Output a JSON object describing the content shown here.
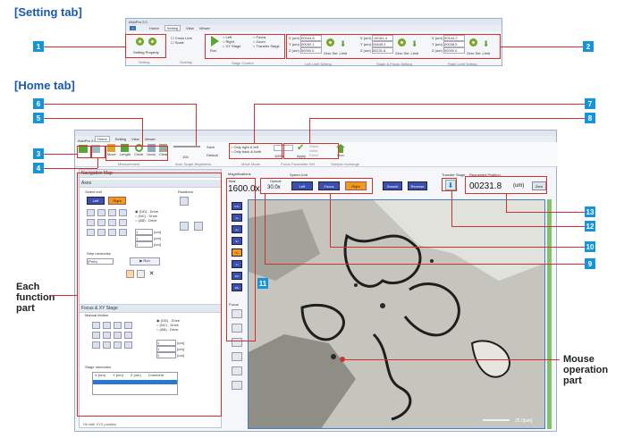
{
  "sections": {
    "setting_tab": "[Setting tab]",
    "home_tab": "[Home tab]"
  },
  "setting": {
    "app_title": "AxioPro 2.0",
    "tabs": [
      "Home",
      "Setting",
      "View",
      "Viewer"
    ],
    "setting_property": "Setting Property",
    "setting_group": "Setting",
    "checkbox_cross_line": "Cross Line",
    "checkbox_scale": "Scale",
    "overlay_group": "Overlay",
    "run_label": "Run",
    "stage_options": [
      "Left",
      "Right",
      "XY Stage"
    ],
    "stage_options2": [
      "Focus",
      "Zoom",
      "Transfer Stage"
    ],
    "stage_group": "Stage Control",
    "coord_groups": [
      {
        "x": "00044.8",
        "y": "00092.1",
        "z": "00000.0",
        "zero": "Zero Set",
        "limit": "Limit",
        "group": "Left Limit Setting"
      },
      {
        "x": "-00181.4",
        "y": "04645.2",
        "z": "00231.8",
        "zero": "Zero Set",
        "limit": "Limit",
        "group": "Stage & Focus Setting"
      },
      {
        "x": "00144.2",
        "y": "00038.5",
        "z": "00000.0",
        "zero": "Zero Set",
        "limit": "Limit",
        "group": "Right Limit Setting"
      }
    ],
    "axis_labels": [
      "X (um)",
      "Y (um)",
      "Z (um)"
    ]
  },
  "home": {
    "app_title": "AxioPro 2.0",
    "tabs": [
      "Home",
      "Setting",
      "View",
      "Viewer"
    ],
    "ribbon_buttons": [
      "Move",
      "Length",
      "Circle",
      "Undo",
      "Clear"
    ],
    "measurement_group": "Measurement",
    "zoom_value": "100",
    "save": "Save",
    "default": "Default",
    "auto_brightness": "Auto Target Brightness",
    "scan_options": [
      "Only right & left",
      "Only back & forth"
    ],
    "scan_group": "Move Mode",
    "focus_mode": "100%",
    "apply": "Apply",
    "focus_opts": [
      "Glass",
      "Initial",
      "Fixed"
    ],
    "focus_group": "Focus Parameter Set",
    "run": "Run",
    "sample_group": "Sample exchange",
    "nav_map": "Navigation Map",
    "axes_panel": "Axes",
    "select_unit": "Select unit",
    "left": "Left",
    "right": "Right",
    "rotations": "Rotations",
    "drive_opts": [
      "(DD) - Drive",
      "(NC) - Drive",
      "(AB) - Drive"
    ],
    "step_unit": "[um]",
    "step_values": [
      "1",
      "1",
      "1"
    ],
    "step_memories": "Step memories",
    "step_select": "(Pmb)",
    "run_btn": "Run",
    "focus_xy": "Focus & XY Stage",
    "manual_motion": "Manual Motion",
    "stage_memories": "Stage memories",
    "table_headers": [
      "X (um)",
      "Y (um)",
      "Z (um)",
      "Comment"
    ],
    "status_line": "Ok with XYZ position",
    "magnifications": "Magnifications",
    "total_label": "Total",
    "optical_label": "Optical",
    "total_value": "1600.0x",
    "optical_value": "30.0x",
    "mag_buttons": [
      "0.5x",
      "1x",
      "2x",
      "3x",
      "5x",
      "7x",
      "10x",
      "20x"
    ],
    "focus_label": "Focus",
    "speed_unit": "Speed Unit",
    "unit_buttons": [
      "Left",
      "Focus",
      "Right"
    ],
    "search": "Search",
    "reverse": "Reverse",
    "transfer_stage": "Transfer Stage",
    "requested_position": "Requested Position",
    "position_value": "00231.8",
    "position_unit": "(um)",
    "zero_btn": "Zero",
    "scale_bar": "25.0[um]"
  },
  "labels": {
    "each_function": "Each function part",
    "mouse_operation": "Mouse operation part"
  },
  "callouts": [
    "1",
    "2",
    "3",
    "4",
    "5",
    "6",
    "7",
    "8",
    "9",
    "10",
    "11",
    "12",
    "13"
  ],
  "colors": {
    "callout": "#1794d8",
    "highlight": "#d0312d",
    "button_blue": "#3a4fb0",
    "button_orange": "#f29a1f",
    "title_blue": "#1a5aa8"
  }
}
